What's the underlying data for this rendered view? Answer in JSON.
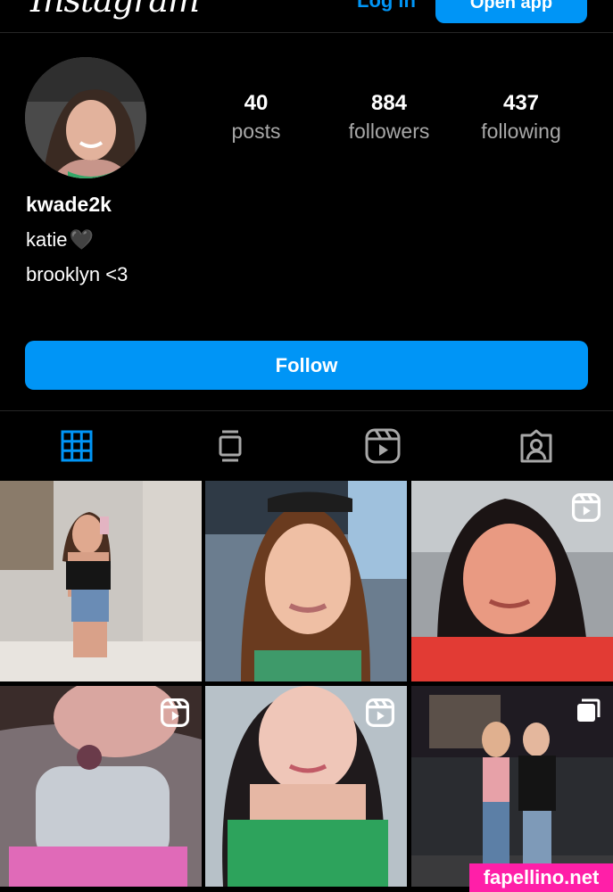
{
  "header": {
    "logo_text": "Instagram",
    "login_label": "Log in",
    "open_app_label": "Open app"
  },
  "profile": {
    "username": "kwade2k",
    "bio_name": "katie",
    "bio_emoji": "🖤",
    "bio_line2": "brooklyn <3",
    "stats": [
      {
        "value": "40",
        "label": "posts"
      },
      {
        "value": "884",
        "label": "followers"
      },
      {
        "value": "437",
        "label": "following"
      }
    ]
  },
  "follow_label": "Follow",
  "tabs": [
    {
      "name": "posts-grid",
      "icon": "grid-icon",
      "active": true
    },
    {
      "name": "guides",
      "icon": "guide-icon",
      "active": false
    },
    {
      "name": "reels",
      "icon": "reels-icon",
      "active": false
    },
    {
      "name": "tagged",
      "icon": "tagged-icon",
      "active": false
    }
  ],
  "colors": {
    "accent": "#0095f6",
    "background": "#000000",
    "secondary_text": "#a8a8a8",
    "watermark": "#ff1fa8"
  },
  "posts": [
    {
      "type": "photo",
      "badge": ""
    },
    {
      "type": "photo",
      "badge": ""
    },
    {
      "type": "reel",
      "badge": "reel-icon"
    },
    {
      "type": "reel",
      "badge": "reel-icon"
    },
    {
      "type": "reel",
      "badge": "reel-icon"
    },
    {
      "type": "carousel",
      "badge": "carousel-icon"
    }
  ],
  "watermark": "fapellino.net"
}
